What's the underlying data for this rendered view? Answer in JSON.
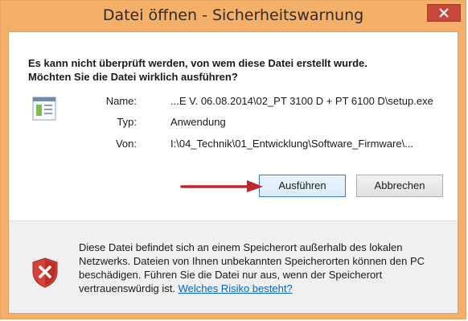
{
  "dialog": {
    "title": "Datei öffnen - Sicherheitswarnung",
    "headline_line1": "Es kann nicht überprüft werden, von wem diese Datei erstellt wurde.",
    "headline_line2": "Möchten Sie die Datei wirklich ausführen?",
    "fields": {
      "name_label": "Name:",
      "name_value": "...E V. 06.08.2014\\02_PT 3100 D + PT 6100 D\\setup.exe",
      "type_label": "Typ:",
      "type_value": "Anwendung",
      "from_label": "Von:",
      "from_value": "I:\\04_Technik\\01_Entwicklung\\Software_Firmware\\..."
    },
    "buttons": {
      "run": "Ausführen",
      "cancel": "Abbrechen"
    },
    "warning": {
      "text": "Diese Datei befindet sich an einem Speicherort außerhalb des lokalen Netzwerks. Dateien von Ihnen unbekannten Speicherorten können den PC beschädigen. Führen Sie die Datei nur aus, wenn der Speicherort vertrauenswürdig ist.",
      "link": "Welches Risiko besteht?"
    }
  },
  "colors": {
    "titlebar": "#f4b068",
    "close": "#c7473b",
    "arrow": "#c0272d",
    "link": "#0066cc"
  },
  "icons": {
    "close": "close-icon",
    "file": "application-file-icon",
    "shield": "shield-warning-icon",
    "arrow": "arrow-right-icon"
  }
}
